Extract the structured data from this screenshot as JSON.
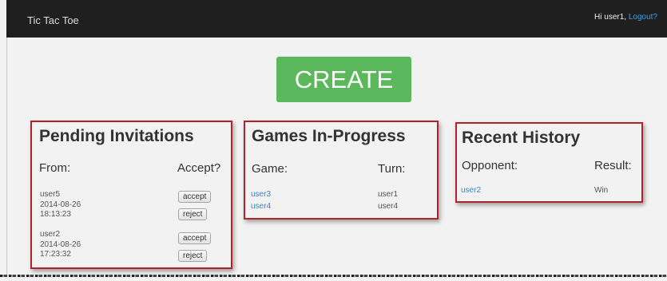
{
  "header": {
    "app_title": "Tic Tac Toe",
    "greeting": "Hi user1,",
    "logout_label": "Logout?"
  },
  "create_label": "CREATE",
  "pending": {
    "title": "Pending Invitations",
    "col_from": "From:",
    "col_accept": "Accept?",
    "invitations": [
      {
        "user": "user5",
        "date": "2014-08-26",
        "time": "18:13:23",
        "accept": "accept",
        "reject": "reject"
      },
      {
        "user": "user2",
        "date": "2014-08-26",
        "time": "17:23:32",
        "accept": "accept",
        "reject": "reject"
      }
    ]
  },
  "games": {
    "title": "Games In-Progress",
    "col_game": "Game:",
    "col_turn": "Turn:",
    "rows": [
      {
        "game": "user3",
        "turn": "user1"
      },
      {
        "game": "user4",
        "turn": "user4"
      }
    ]
  },
  "history": {
    "title": "Recent History",
    "col_opponent": "Opponent:",
    "col_result": "Result:",
    "rows": [
      {
        "opponent": "user2",
        "result": "Win"
      }
    ]
  }
}
